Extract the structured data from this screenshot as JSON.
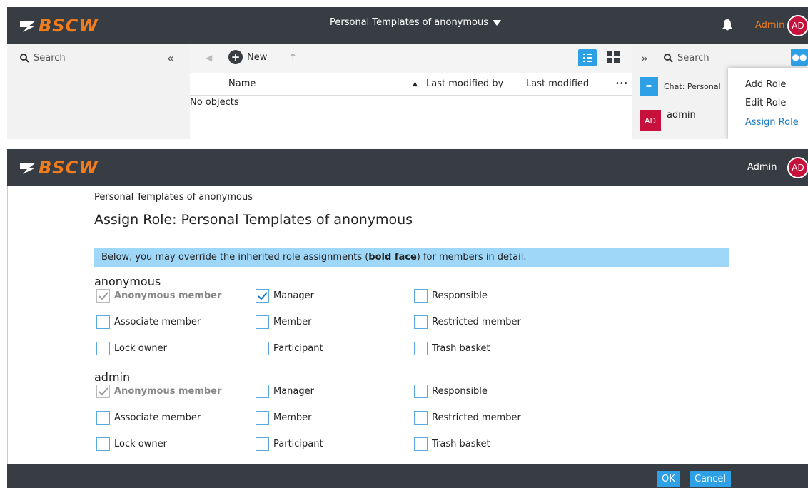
{
  "top": {
    "logo": "BSCW",
    "title": "Personal Templates of anonymous",
    "admin": "Admin",
    "avatar": "AD",
    "search_label": "Search",
    "new_label": "New",
    "columns": {
      "name": "Name",
      "last_modified_by": "Last modified by",
      "last_modified": "Last modified",
      "more": "•••"
    },
    "no_objects": "No objects",
    "right_search": "Search",
    "chat_label": "Chat: Personal",
    "member_name": "admin",
    "menu": [
      "Add Role",
      "Edit Role",
      "Assign Role"
    ]
  },
  "page": {
    "logo": "BSCW",
    "admin": "Admin",
    "avatar": "AD",
    "breadcrumb": "Personal Templates of anonymous",
    "title": "Assign Role: Personal Templates of anonymous",
    "info_pre": "Below, you may override the inherited role assignments (",
    "info_bold": "bold face",
    "info_post": ") for members in detail.",
    "groups": [
      {
        "name": "anonymous",
        "roles": [
          "Anonymous member",
          "Manager",
          "Responsible",
          "Associate member",
          "Member",
          "Restricted member",
          "Lock owner",
          "Participant",
          "Trash basket"
        ]
      },
      {
        "name": "admin",
        "roles": [
          "Anonymous member",
          "Manager",
          "Responsible",
          "Associate member",
          "Member",
          "Restricted member",
          "Lock owner",
          "Participant",
          "Trash basket"
        ]
      }
    ],
    "ok": "OK",
    "cancel": "Cancel"
  }
}
